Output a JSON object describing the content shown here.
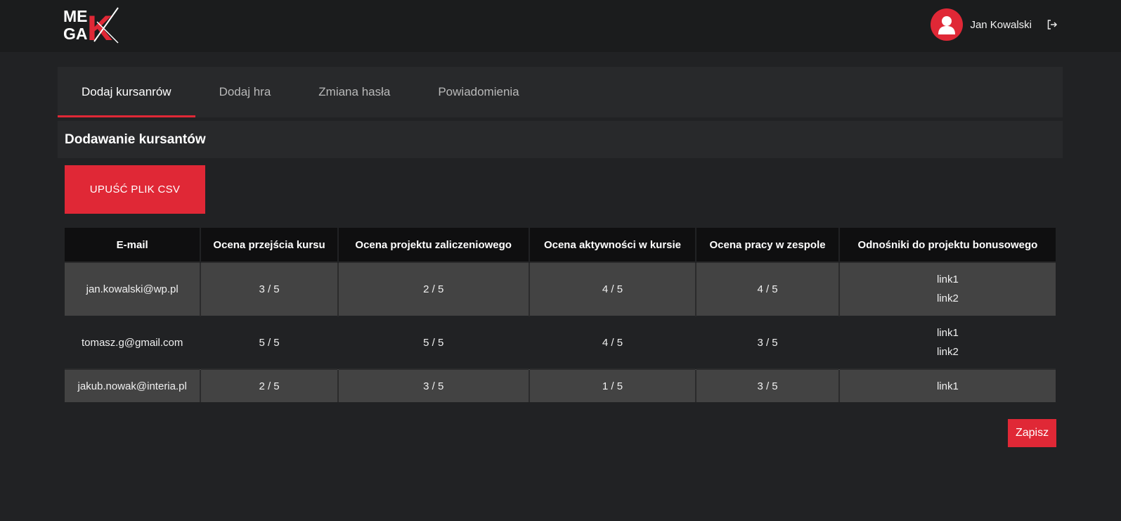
{
  "header": {
    "logo_text_top": "ME",
    "logo_text_bottom": "GA",
    "logo_letter": "K",
    "user_name": "Jan Kowalski",
    "avatar_icon": "user-icon",
    "logout_icon": "logout-icon"
  },
  "tabs": [
    {
      "label": "Dodaj kursanrów",
      "active": true
    },
    {
      "label": "Dodaj hra",
      "active": false
    },
    {
      "label": "Zmiana hasła",
      "active": false
    },
    {
      "label": "Powiadomienia",
      "active": false
    }
  ],
  "section": {
    "title": "Dodawanie kursantów",
    "upload_button": "UPUŚĆ PLIK CSV"
  },
  "table": {
    "columns": [
      "E-mail",
      "Ocena przejścia kursu",
      "Ocena projektu zaliczeniowego",
      "Ocena aktywności w kursie",
      "Ocena pracy w zespole",
      "Odnośniki do projektu bonusowego"
    ],
    "rows": [
      {
        "email": "jan.kowalski@wp.pl",
        "course": "3 / 5",
        "project": "2 / 5",
        "activity": "4 / 5",
        "team": "4 / 5",
        "links": [
          "link1",
          "link2"
        ]
      },
      {
        "email": "tomasz.g@gmail.com",
        "course": "5 / 5",
        "project": "5 / 5",
        "activity": "4 / 5",
        "team": "3 / 5",
        "links": [
          "link1",
          "link2"
        ]
      },
      {
        "email": "jakub.nowak@interia.pl",
        "course": "2 / 5",
        "project": "3 / 5",
        "activity": "1 / 5",
        "team": "3 / 5",
        "links": [
          "link1"
        ]
      }
    ]
  },
  "actions": {
    "save_label": "Zapisz"
  },
  "colors": {
    "accent": "#e02836",
    "background": "#212224",
    "panel": "#28292b"
  }
}
